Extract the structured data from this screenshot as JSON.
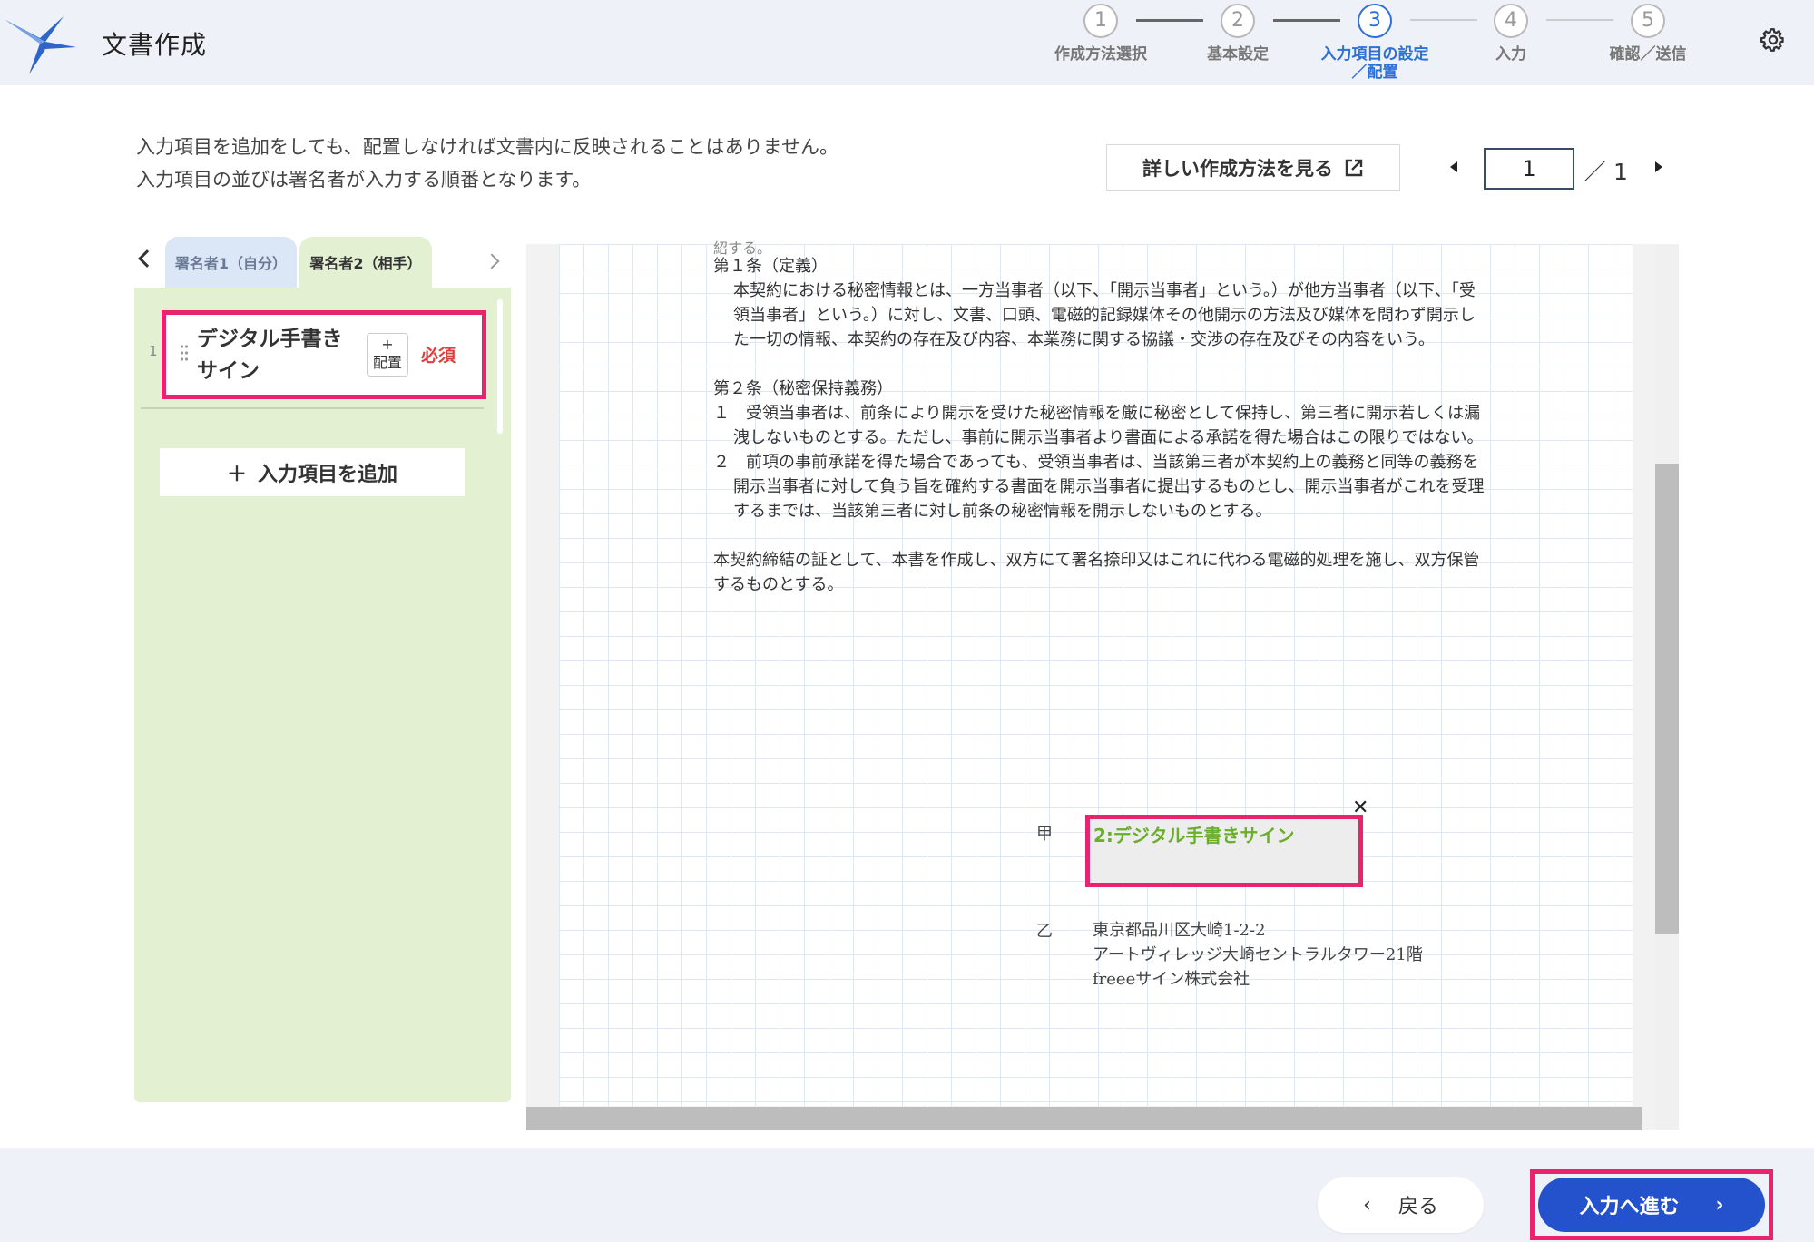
{
  "header": {
    "title": "文書作成",
    "steps": [
      {
        "num": "1",
        "label": "作成方法選択"
      },
      {
        "num": "2",
        "label": "基本設定"
      },
      {
        "num": "3",
        "label": "入力項目の設定／配置"
      },
      {
        "num": "4",
        "label": "入力"
      },
      {
        "num": "5",
        "label": "確認／送信"
      }
    ],
    "active_step": "3"
  },
  "instructions": {
    "line1": "入力項目を追加をしても、配置しなければ文書内に反映されることはありません。",
    "line2": "入力項目の並びは署名者が入力する順番となります。"
  },
  "howto_button": "詳しい作成方法を見る",
  "pager": {
    "current": "1",
    "total": "／ 1"
  },
  "signer_tabs": [
    "署名者1（自分）",
    "署名者2（相手）"
  ],
  "input_items": [
    {
      "num": "1",
      "name_line1": "デジタル手書き",
      "name_line2": "サイン",
      "place_icon": "+",
      "place_label": "配置",
      "required": "必須"
    }
  ],
  "add_item_label": "入力項目を追加",
  "document": {
    "top_clip": "紹する。",
    "lines": [
      {
        "text": "第１条（定義）",
        "cls": ""
      },
      {
        "text": "本契約における秘密情報とは、一方当事者（以下、「開示当事者」という。）が他方当事者（以下、「受領当事者」という。）に対し、文書、口頭、電磁的記録媒体その他開示の方法及び媒体を問わず開示した一切の情報、本契約の存在及び内容、本業務に関する協議・交渉の存在及びその内容をいう。",
        "cls": "ind"
      },
      {
        "text": "",
        "cls": "gap"
      },
      {
        "text": "第２条（秘密保持義務）",
        "cls": ""
      },
      {
        "text": "１　受領当事者は、前条により開示を受けた秘密情報を厳に秘密として保持し、第三者に開示若しくは漏洩しないものとする。ただし、事前に開示当事者より書面による承諾を得た場合はこの限りではない。",
        "cls": "hang"
      },
      {
        "text": "２　前項の事前承諾を得た場合であっても、受領当事者は、当該第三者が本契約上の義務と同等の義務を開示当事者に対して負う旨を確約する書面を開示当事者に提出するものとし、開示当事者がこれを受理するまでは、当該第三者に対し前条の秘密情報を開示しないものとする。",
        "cls": "hang"
      },
      {
        "text": "",
        "cls": "gap"
      },
      {
        "text": "本契約締結の証として、本書を作成し、双方にて署名捺印又はこれに代わる電磁的処理を施し、双方保管するものとする。",
        "cls": ""
      }
    ],
    "party_a": "甲",
    "party_b": "乙",
    "sign_field_label": "2:デジタル手書きサイン",
    "address": [
      "東京都品川区大崎1-2-2",
      "アートヴィレッジ大崎セントラルタワー21階",
      "freeeサイン株式会社"
    ]
  },
  "footer": {
    "back_label": "戻る",
    "next_label": "入力へ進む"
  },
  "colors": {
    "accent_blue": "#2352cc",
    "highlight_pink": "#e8246e",
    "panel_green": "#e4f0d2",
    "field_green": "#6aae2a",
    "required_red": "#e03c3c"
  }
}
